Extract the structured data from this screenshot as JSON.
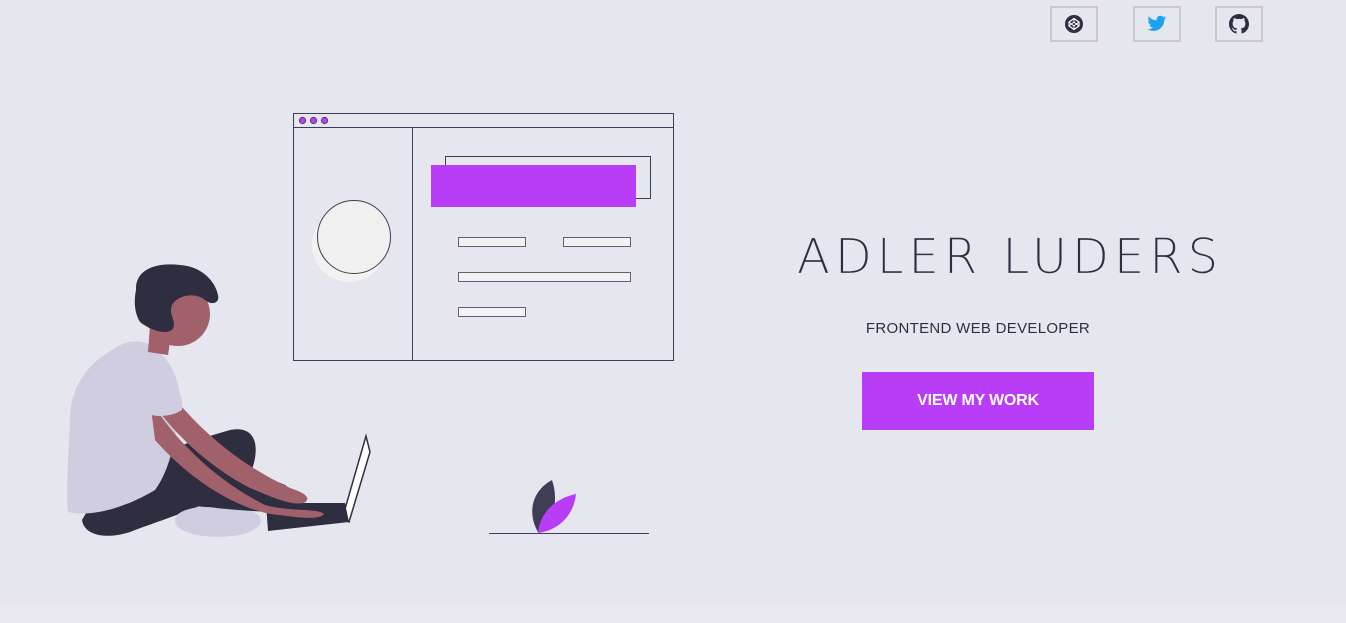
{
  "header": {
    "social_links": [
      {
        "name": "codepen",
        "icon": "codepen-icon",
        "color": "#2f2e41"
      },
      {
        "name": "twitter",
        "icon": "twitter-icon",
        "color": "#1da1f2"
      },
      {
        "name": "github",
        "icon": "github-icon",
        "color": "#2f2e41"
      }
    ]
  },
  "hero": {
    "name": "ADLER LUDERS",
    "subtitle": "FRONTEND WEB DEVELOPER",
    "cta_label": "VIEW MY WORK"
  },
  "colors": {
    "background": "#e6e6ee",
    "accent": "#b93cf6",
    "text_dark": "#2f2e41"
  }
}
